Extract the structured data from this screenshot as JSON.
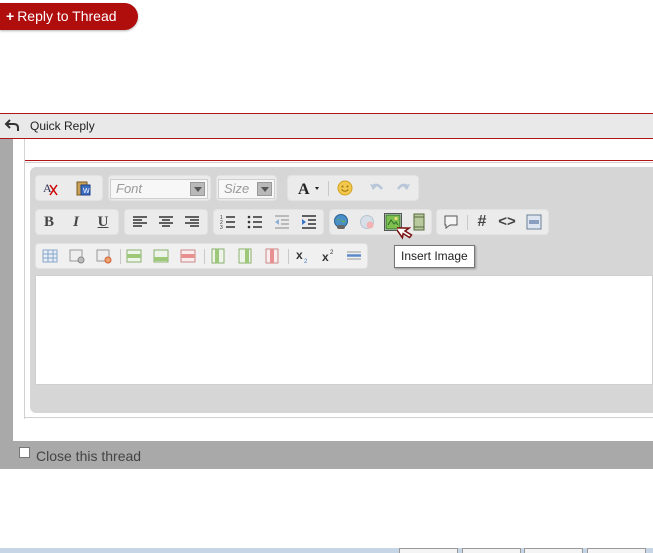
{
  "reply_button": {
    "plus": "+",
    "label": "Reply to Thread"
  },
  "quick_reply": {
    "title": "Quick Reply"
  },
  "toolbar": {
    "font_placeholder": "Font",
    "size_placeholder": "Size",
    "bold": "B",
    "italic": "I",
    "underline": "U",
    "hash": "#",
    "code": "<>"
  },
  "tooltip": {
    "insert_image": "Insert Image"
  },
  "close_thread": {
    "label": "Close this thread",
    "checked": false
  },
  "colors": {
    "accent": "#b00d0d",
    "divider": "#b3141a",
    "toolbar_bg": "#d6d6d6"
  }
}
